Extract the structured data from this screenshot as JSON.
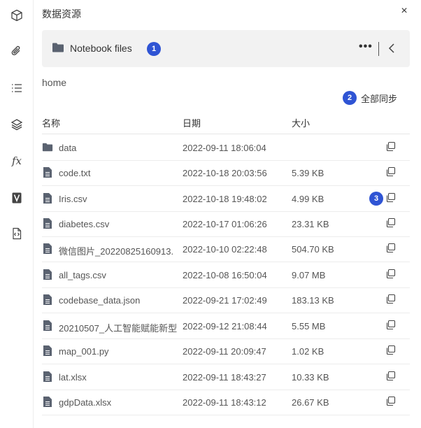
{
  "sidebar": {
    "items": [
      {
        "name": "cube-icon"
      },
      {
        "name": "paperclip-icon"
      },
      {
        "name": "list-icon"
      },
      {
        "name": "layers-icon"
      },
      {
        "name": "fx-icon",
        "text": "fx"
      },
      {
        "name": "v-icon"
      },
      {
        "name": "code-file-icon"
      }
    ]
  },
  "panel": {
    "title": "数据资源",
    "close": "×"
  },
  "folder_bar": {
    "label": "Notebook files",
    "badge": "1",
    "more": "•••"
  },
  "breadcrumb": "home",
  "sync": {
    "badge": "2",
    "label": "全部同步"
  },
  "table": {
    "headers": {
      "name": "名称",
      "date": "日期",
      "size": "大小"
    },
    "rows": [
      {
        "type": "folder",
        "name": "data",
        "date": "2022-09-11 18:06:04",
        "size": ""
      },
      {
        "type": "file",
        "name": "code.txt",
        "date": "2022-10-18 20:03:56",
        "size": "5.39 KB"
      },
      {
        "type": "file",
        "name": "Iris.csv",
        "date": "2022-10-18 19:48:02",
        "size": "4.99 KB",
        "badge": "3"
      },
      {
        "type": "file",
        "name": "diabetes.csv",
        "date": "2022-10-17 01:06:26",
        "size": "23.31 KB"
      },
      {
        "type": "file",
        "name": "微信图片_20220825160913.",
        "date": "2022-10-10 02:22:48",
        "size": "504.70 KB"
      },
      {
        "type": "file",
        "name": "all_tags.csv",
        "date": "2022-10-08 16:50:04",
        "size": "9.07 MB"
      },
      {
        "type": "file",
        "name": "codebase_data.json",
        "date": "2022-09-21 17:02:49",
        "size": "183.13 KB"
      },
      {
        "type": "file",
        "name": "20210507_人工智能赋能新型",
        "date": "2022-09-12 21:08:44",
        "size": "5.55 MB"
      },
      {
        "type": "file",
        "name": "map_001.py",
        "date": "2022-09-11 20:09:47",
        "size": "1.02 KB"
      },
      {
        "type": "file",
        "name": "lat.xlsx",
        "date": "2022-09-11 18:43:27",
        "size": "10.33 KB"
      },
      {
        "type": "file",
        "name": "gdpData.xlsx",
        "date": "2022-09-11 18:43:12",
        "size": "26.67 KB"
      }
    ]
  },
  "colors": {
    "accent": "#2f54d4",
    "icon": "#5a6270",
    "bar_bg": "#f2f2f2"
  }
}
